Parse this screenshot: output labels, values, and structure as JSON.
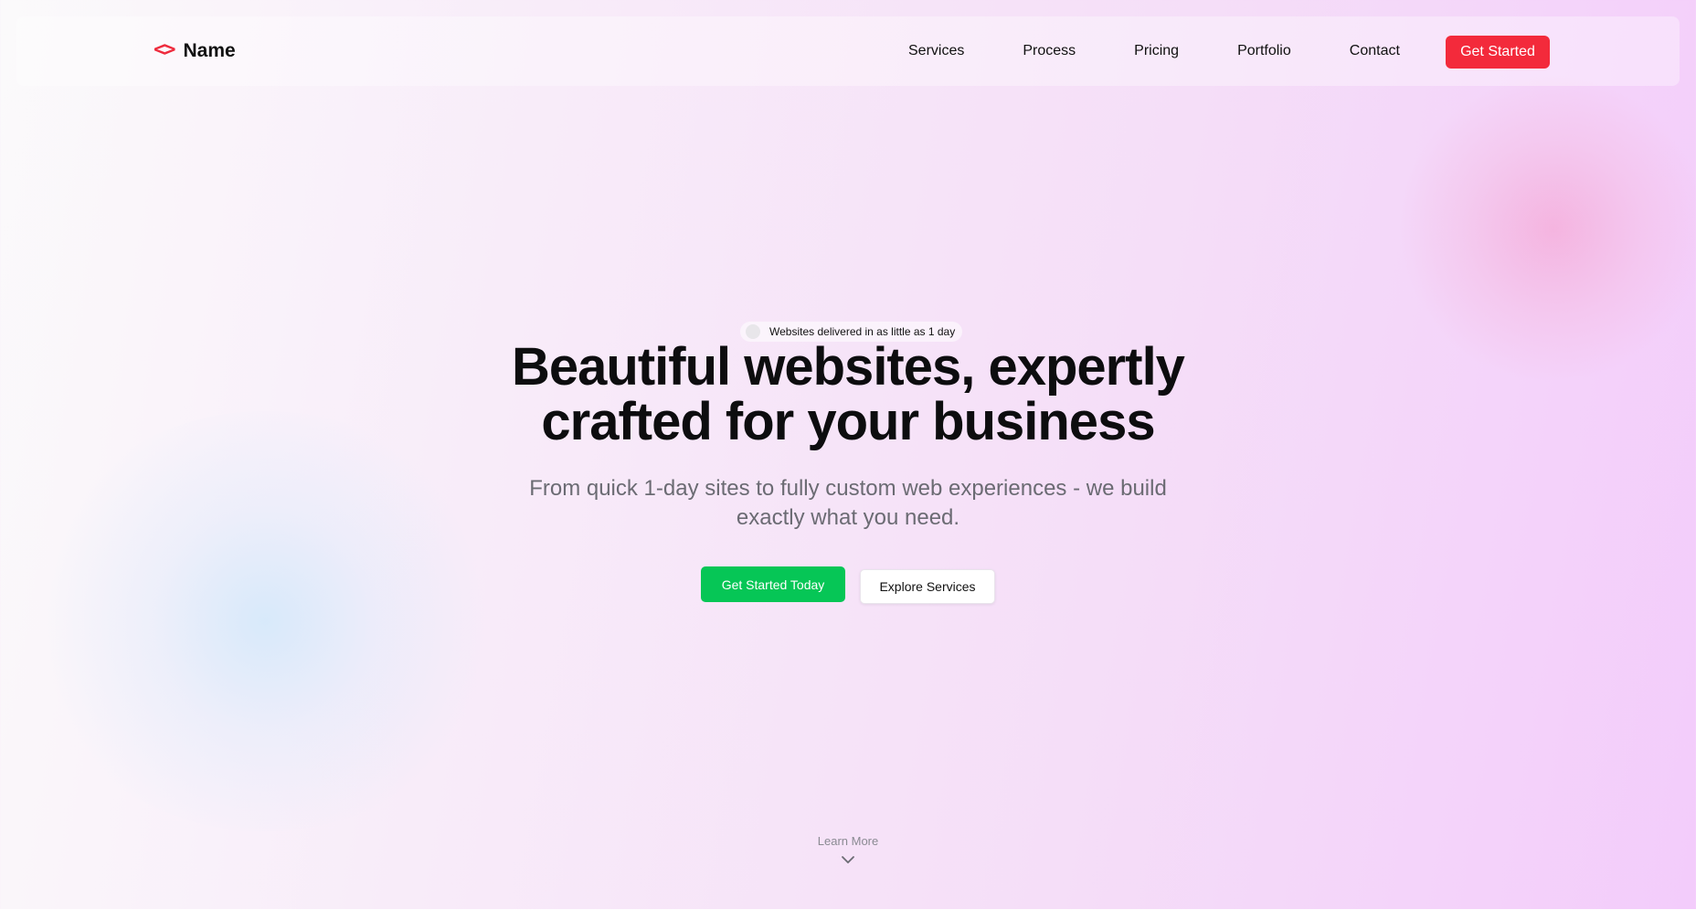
{
  "brand": {
    "icon": "code-brackets-icon",
    "name": "Name"
  },
  "nav": {
    "links": [
      "Services",
      "Process",
      "Pricing",
      "Portfolio",
      "Contact"
    ],
    "cta_label": "Get Started"
  },
  "hero": {
    "badge_text": "Websites delivered in as little as 1 day",
    "title_line1": "Beautiful websites, expertly",
    "title_line2": "crafted for your business",
    "subtitle_line1": "From quick 1-day sites to fully custom web experiences - we build",
    "subtitle_line2": "exactly what you need.",
    "primary_button": "Get Started Today",
    "secondary_button": "Explore Services"
  },
  "scroll": {
    "label": "Learn More",
    "icon": "chevron-down-icon"
  },
  "colors": {
    "accent_red": "#f32a3b",
    "accent_green": "#06c656"
  }
}
